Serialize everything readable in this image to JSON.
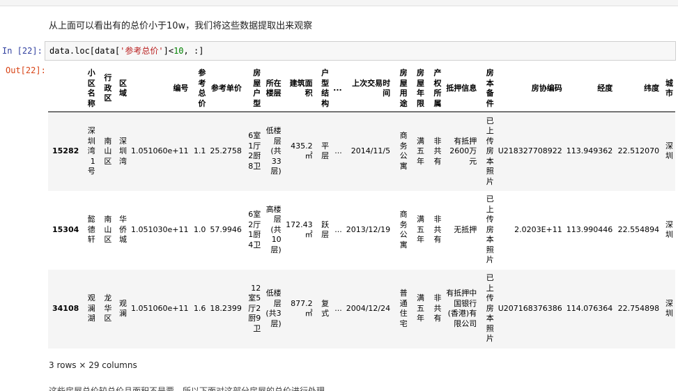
{
  "markdown_text": "从上面可以看出有的总价小于10w，我们将这些数据提取出来观察",
  "input_prompt": "In  [22]:",
  "output_prompt": "Out[22]:",
  "code": {
    "p1": "data.loc[data[",
    "str": "'参考总价'",
    "op": "]<",
    "num": "10",
    "p2": ", :]"
  },
  "columns": [
    "",
    "小区名称",
    "行政区",
    "区域",
    "编号",
    "参考总价",
    "参考单价",
    "房屋户型",
    "所在楼层",
    "建筑面积",
    "户型结构",
    "...",
    "上次交易时间",
    "房屋用途",
    "房屋年限",
    "产权所属",
    "抵押信息",
    "房本备件",
    "房协编码",
    "经度",
    "纬度",
    "城市"
  ],
  "rows": [
    {
      "idx": "15282",
      "cells": [
        "深圳湾1号",
        "南山区",
        "深圳湾",
        "1.051060e+11",
        "1.1",
        "25.2758",
        "6室1厅2厨8卫",
        "低楼层(共33层)",
        "435.2㎡",
        "平层",
        "...",
        "2014/11/5",
        "商务公寓",
        "满五年",
        "非共有",
        "有抵押2600万元",
        "已上传房本照片",
        "U218327708922",
        "113.949362",
        "22.512070",
        "深圳"
      ]
    },
    {
      "idx": "15304",
      "cells": [
        "懿德轩",
        "南山区",
        "华侨城",
        "1.051030e+11",
        "1.0",
        "57.9946",
        "6室2厅1厨4卫",
        "高楼层(共10层)",
        "172.43㎡",
        "跃层",
        "...",
        "2013/12/19",
        "商务公寓",
        "满五年",
        "非共有",
        "无抵押",
        "已上传房本照片",
        "2.0203E+11",
        "113.990446",
        "22.554894",
        "深圳"
      ]
    },
    {
      "idx": "34108",
      "cells": [
        "观澜湖",
        "龙华区",
        "观澜",
        "1.051060e+11",
        "1.6",
        "18.2399",
        "12室5厅2厨9卫",
        "低楼层(共3层)",
        "877.2㎡",
        "复式",
        "...",
        "2004/12/24",
        "普通住宅",
        "满五年",
        "非共有",
        "有抵押中国银行(香港)有限公司",
        "已上传房本照片",
        "U207168376386",
        "114.076364",
        "22.754898",
        "深圳"
      ]
    }
  ],
  "footer": "3 rows × 29 columns",
  "cut_text": "这些房屋总价较总价且面积不是要，所以下面对这部分房屋的总价进行处理"
}
